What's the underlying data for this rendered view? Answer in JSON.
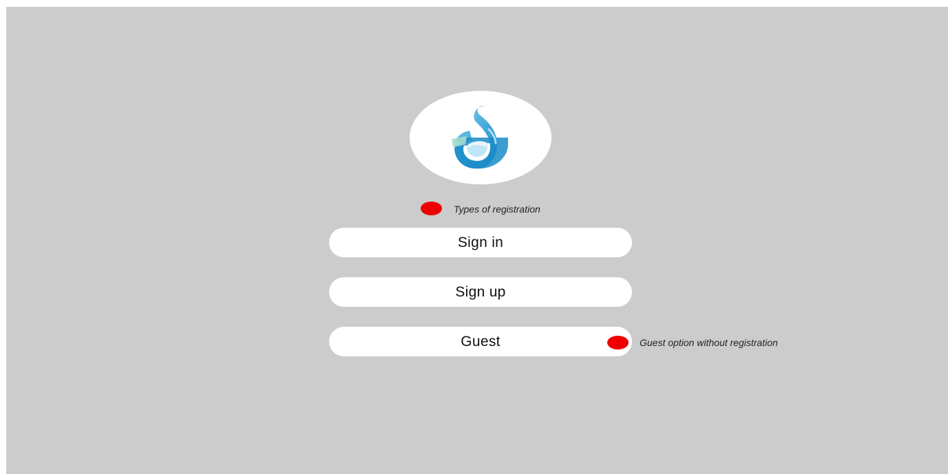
{
  "app": {
    "logo_icon": "water-drop-icon",
    "brand_colors": {
      "primary": "#1e9fd6",
      "light": "#6fc6ee",
      "accent": "#9ed8c8"
    }
  },
  "annotations": {
    "registration_types": "Types of registration",
    "guest_note": "Guest option without registration",
    "marker_color": "#ee0000"
  },
  "buttons": {
    "sign_in": "Sign in",
    "sign_up": "Sign up",
    "guest": "Guest"
  },
  "colors": {
    "background": "#cccccc",
    "button": "#ffffff"
  }
}
